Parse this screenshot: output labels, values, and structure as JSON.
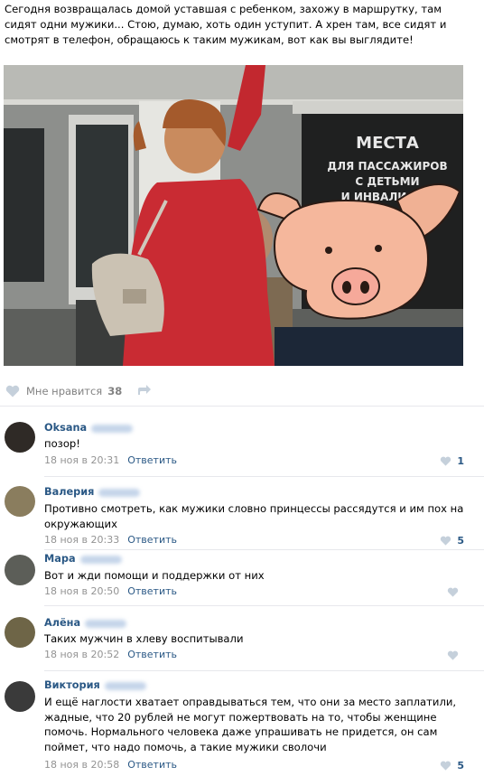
{
  "post": {
    "text": "Сегодня возвращалась домой уставшая с ребенком, захожу в маршрутку, там сидят одни мужики... Стою, думаю, хоть один уступит. А хрен там, все сидят и смотрят в телефон, обращаюсь к таким мужикам, вот как вы выглядите!",
    "image_sign_lines": [
      "МЕСТА",
      "ДЛЯ ПАССАЖИРОВ",
      "С ДЕТЬМИ",
      "И ИНВАЛИДОВ"
    ],
    "likes_label": "Мне нравится",
    "likes_count": "38"
  },
  "colors": {
    "link": "#2a5885",
    "muted": "#939393",
    "icon": "#c5d0db",
    "divider": "#e7e8ec"
  },
  "comments": [
    {
      "author": "Oksana",
      "text": "позор!",
      "date": "18 ноя в 20:31",
      "reply": "Ответить",
      "likes": "1",
      "avatar_color": "#2f2a26"
    },
    {
      "author": "Валерия",
      "text": "Противно смотреть, как мужики словно принцессы рассядутся и им пох на окружающих",
      "date": "18 ноя в 20:33",
      "reply": "Ответить",
      "likes": "5",
      "avatar_color": "#8a7d5e"
    },
    {
      "author": "Мара",
      "text": "Вот и жди помощи и поддержки от них",
      "date": "18 ноя в 20:50",
      "reply": "Ответить",
      "likes": "",
      "avatar_color": "#5c5e58"
    },
    {
      "author": "Алёна",
      "text": "Таких мужчин в хлеву воспитывали",
      "date": "18 ноя в 20:52",
      "reply": "Ответить",
      "likes": "",
      "avatar_color": "#6e6547"
    },
    {
      "author": "Виктория",
      "text": "И ещё наглости хватает оправдываться тем, что они за место заплатили, жадные, что 20 рублей не могут пожертвовать на то, чтобы женщине помочь. Нормального человека даже упрашивать не придется, он сам поймет, что надо помочь, а такие мужики сволочи",
      "date": "18 ноя в 20:58",
      "reply": "Ответить",
      "likes": "5",
      "avatar_color": "#3a3a3a"
    }
  ]
}
